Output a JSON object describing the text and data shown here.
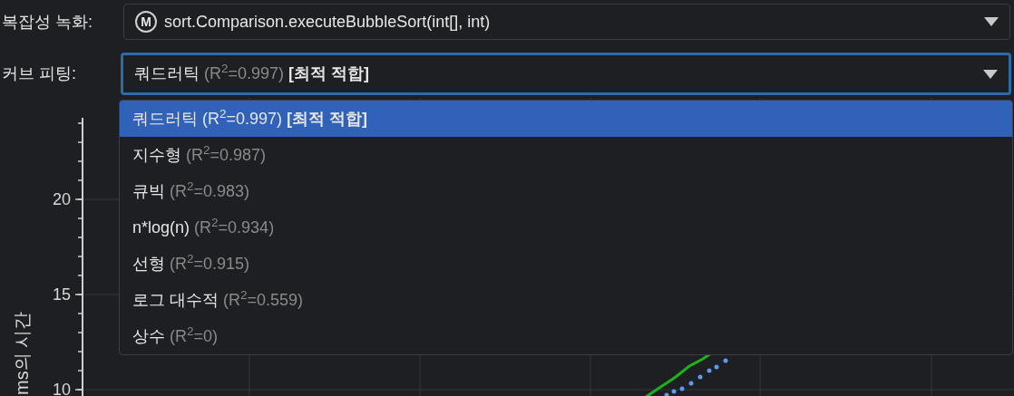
{
  "method_row": {
    "label": "복잡성 녹화:",
    "badge": "M",
    "value": "sort.Comparison.executeBubbleSort(int[], int)"
  },
  "fit_row": {
    "label": "커브 피팅:",
    "focused": true,
    "value": {
      "name": "쿼드러틱",
      "detail": "(R$^{2}$=0.997)",
      "tag": "[최적 적합]"
    },
    "expanded": true,
    "options": [
      {
        "name": "쿼드러틱",
        "detail": "(R$^{2}$=0.997)",
        "tag": "[최적 적합]",
        "selected": true
      },
      {
        "name": "지수형",
        "detail": "(R$^{2}$=0.987)",
        "selected": false
      },
      {
        "name": "큐빅",
        "detail": "(R$^{2}$=0.983)",
        "selected": false
      },
      {
        "name": "n*log(n)",
        "detail": "(R$^{2}$=0.934)",
        "selected": false
      },
      {
        "name": "선형",
        "detail": "(R$^{2}$=0.915)",
        "selected": false
      },
      {
        "name": "로그 대수적",
        "detail": "(R$^{2}$=0.559)",
        "selected": false
      },
      {
        "name": "상수",
        "detail": "(R$^{2}$=0)",
        "selected": false
      }
    ]
  },
  "chart": {
    "y_label": "ms의 시간",
    "y_ticks": [
      "20",
      "15",
      "10"
    ]
  }
}
